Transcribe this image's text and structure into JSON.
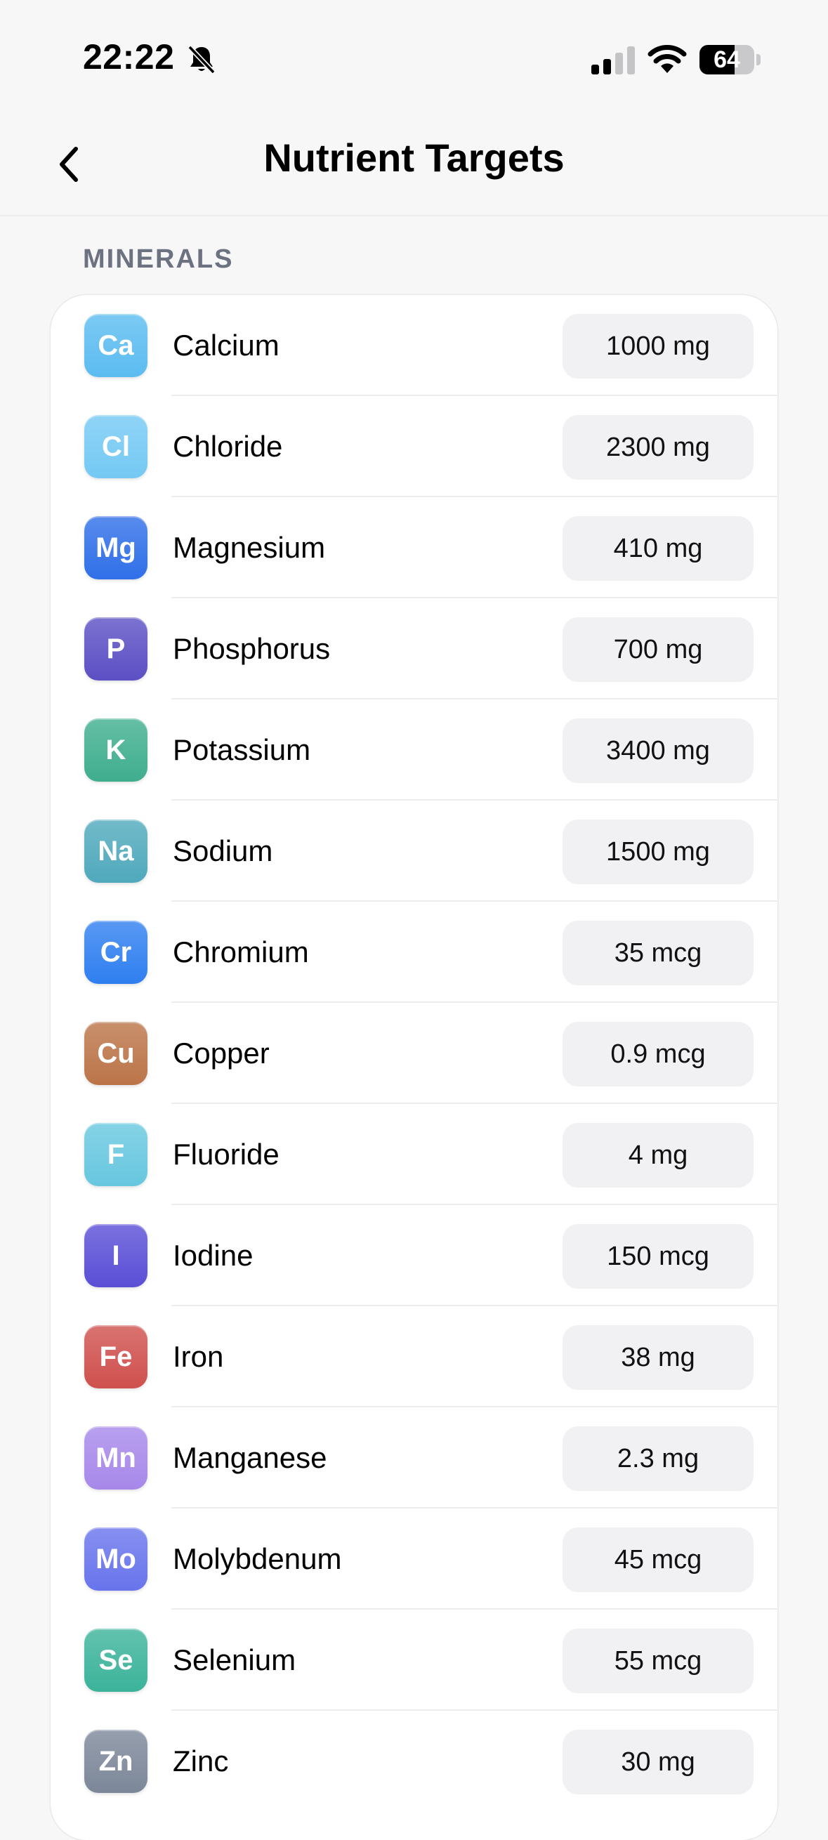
{
  "status_bar": {
    "time": "22:22",
    "battery_percent": "64",
    "battery_level": 0.64
  },
  "nav": {
    "title": "Nutrient Targets"
  },
  "section": {
    "header": "MINERALS"
  },
  "minerals": [
    {
      "symbol": "Ca",
      "name": "Calcium",
      "value": "1000 mg",
      "color": "#5bbcf0"
    },
    {
      "symbol": "Cl",
      "name": "Chloride",
      "value": "2300 mg",
      "color": "#74c9f4"
    },
    {
      "symbol": "Mg",
      "name": "Magnesium",
      "value": "410 mg",
      "color": "#2f6fe8"
    },
    {
      "symbol": "P",
      "name": "Phosphorus",
      "value": "700 mg",
      "color": "#5b4fc4"
    },
    {
      "symbol": "K",
      "name": "Potassium",
      "value": "3400 mg",
      "color": "#3fae8e"
    },
    {
      "symbol": "Na",
      "name": "Sodium",
      "value": "1500 mg",
      "color": "#4fa9bc"
    },
    {
      "symbol": "Cr",
      "name": "Chromium",
      "value": "35 mcg",
      "color": "#2f7ff0"
    },
    {
      "symbol": "Cu",
      "name": "Copper",
      "value": "0.9 mcg",
      "color": "#bb7448"
    },
    {
      "symbol": "F",
      "name": "Fluoride",
      "value": "4 mg",
      "color": "#67c7df"
    },
    {
      "symbol": "I",
      "name": "Iodine",
      "value": "150 mcg",
      "color": "#5a4ed6"
    },
    {
      "symbol": "Fe",
      "name": "Iron",
      "value": "38 mg",
      "color": "#cf504d"
    },
    {
      "symbol": "Mn",
      "name": "Manganese",
      "value": "2.3 mg",
      "color": "#a788ea"
    },
    {
      "symbol": "Mo",
      "name": "Molybdenum",
      "value": "45 mcg",
      "color": "#6874ec"
    },
    {
      "symbol": "Se",
      "name": "Selenium",
      "value": "55 mcg",
      "color": "#3bb39a"
    },
    {
      "symbol": "Zn",
      "name": "Zinc",
      "value": "30 mg",
      "color": "#7c8799"
    }
  ]
}
